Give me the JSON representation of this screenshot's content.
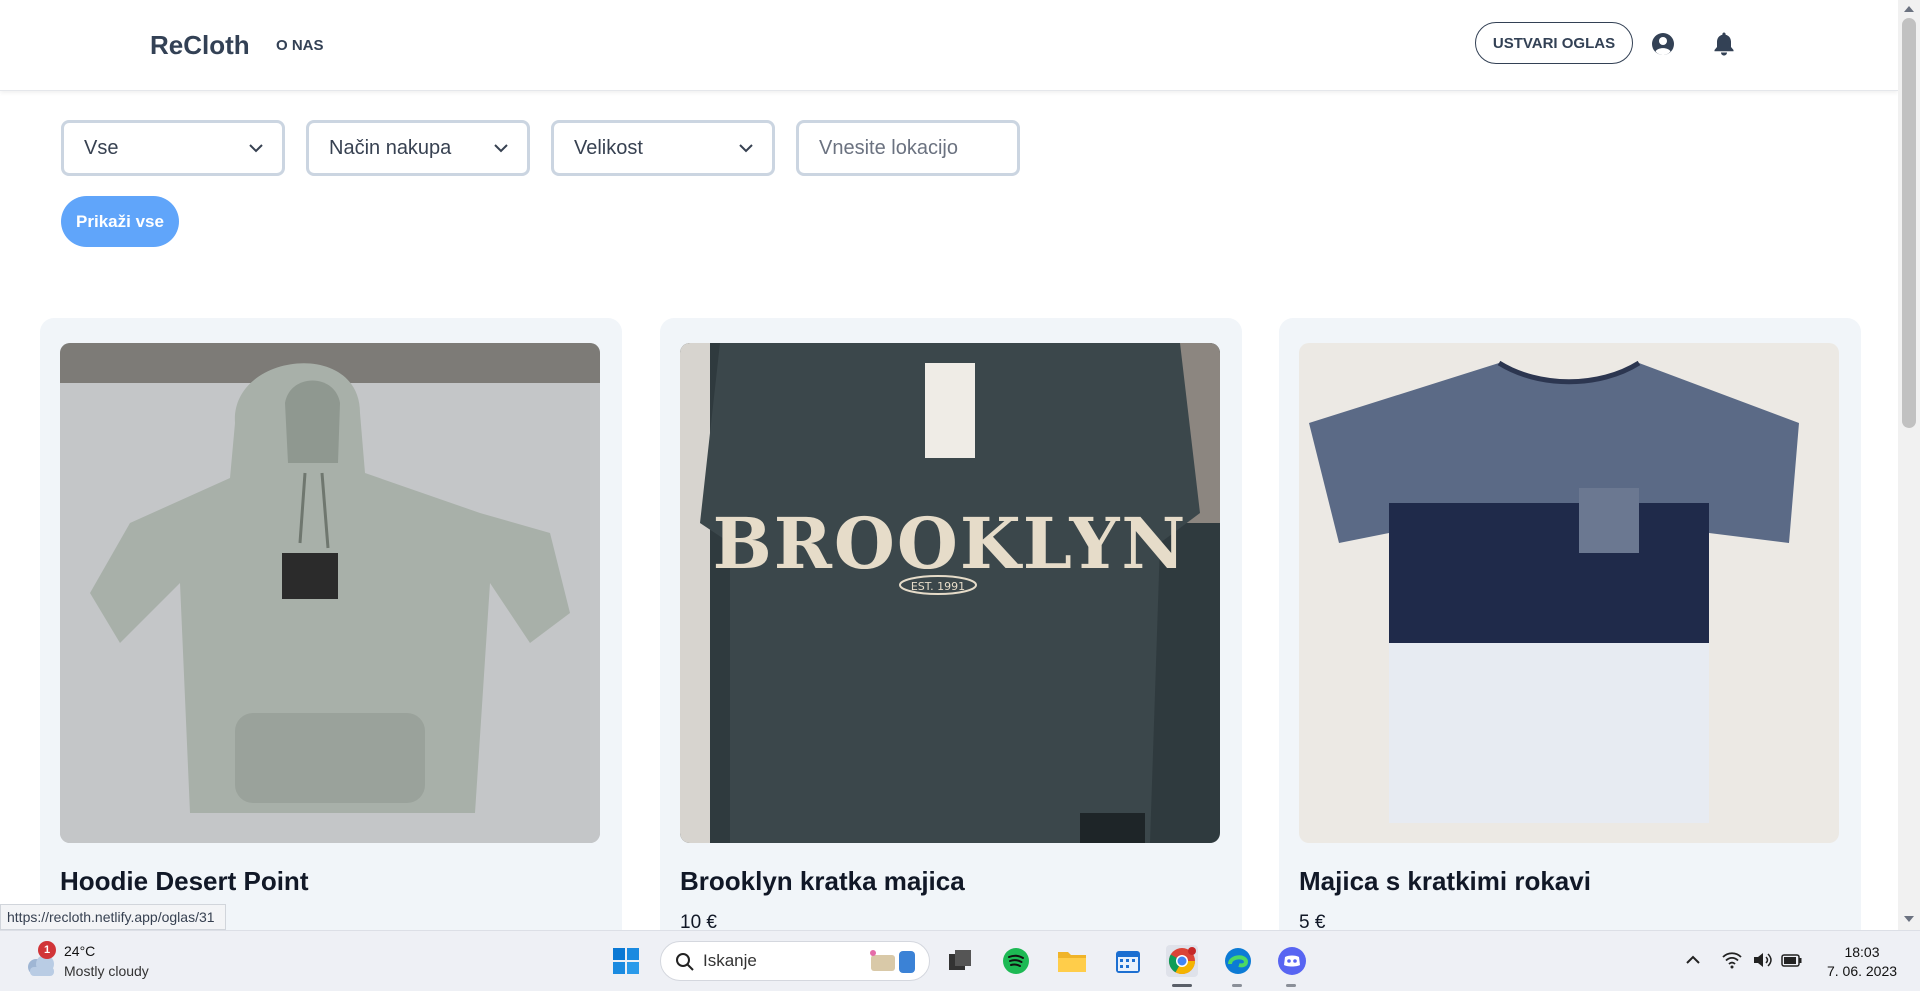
{
  "header": {
    "brand": "ReCloth",
    "nav_about": "O NAS",
    "create_label": "USTVARI OGLAS",
    "user_icon": "user-circle-icon",
    "bell_icon": "bell-icon"
  },
  "filters": {
    "category_value": "Vse",
    "purchase_method_value": "Način nakupa",
    "size_value": "Velikost",
    "location_placeholder": "Vnesite lokacijo",
    "show_all_label": "Prikaži vse"
  },
  "listings": [
    {
      "title": "Hoodie Desert Point",
      "price": "",
      "image": "grey hoodie photo"
    },
    {
      "title": "Brooklyn kratka majica",
      "price": "10 €",
      "image": "brooklyn t-shirt photo"
    },
    {
      "title": "Majica s kratkimi rokavi",
      "price": "5 €",
      "image": "blue white t-shirt photo"
    }
  ],
  "status_url": "https://recloth.netlify.app/oglas/31",
  "taskbar": {
    "weather_temp": "24°C",
    "weather_condition": "Mostly cloudy",
    "weather_badge": "1",
    "search_placeholder": "Iskanje",
    "time": "18:03",
    "date": "7. 06. 2023"
  },
  "colors": {
    "primary_button": "#60a5fa",
    "card_background": "#f1f5f9",
    "text_dark": "#334155"
  }
}
